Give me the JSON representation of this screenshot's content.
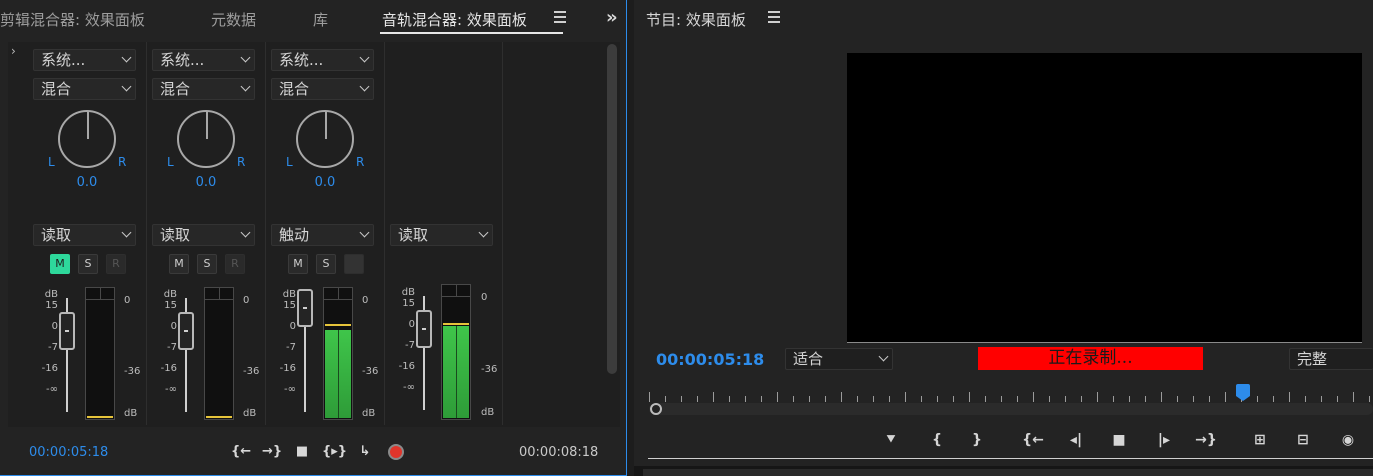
{
  "left_panel": {
    "tabs": [
      "剪辑混合器: 效果面板",
      "元数据",
      "库",
      "音轨混合器: 效果面板"
    ],
    "active_tab": "音轨混合器: 效果面板",
    "overflow_glyph": "»",
    "expander_glyph": "›",
    "tracks": [
      {
        "output": "系统...",
        "mode": "混合",
        "pan_left": "L",
        "pan_right": "R",
        "pan_value": "0.0",
        "automation": "读取",
        "mute": "M",
        "solo": "S",
        "record": "R",
        "mute_on": true,
        "meter_level": 0.0
      },
      {
        "output": "系统...",
        "mode": "混合",
        "pan_left": "L",
        "pan_right": "R",
        "pan_value": "0.0",
        "automation": "读取",
        "mute": "M",
        "solo": "S",
        "record": "R",
        "mute_on": false,
        "meter_level": 0.0
      },
      {
        "output": "系统...",
        "mode": "混合",
        "pan_left": "L",
        "pan_right": "R",
        "pan_value": "0.0",
        "automation": "触动",
        "mute": "M",
        "solo": "S",
        "record": "",
        "mute_on": false,
        "meter_level": 0.8
      },
      {
        "automation": "读取",
        "meter_level": 0.8
      }
    ],
    "db_scale_left": [
      "dB",
      "15",
      "0",
      "-7",
      "-16",
      "-∞"
    ],
    "db_scale_right": [
      "0",
      "-36",
      "dB"
    ],
    "current_time": "00:00:05:18",
    "duration": "00:00:08:18",
    "transport_icons": [
      "go-to-in-icon",
      "go-to-out-icon",
      "stop-icon",
      "loop-in-out-icon",
      "loop-icon",
      "record-icon"
    ]
  },
  "right_panel": {
    "title": "节目: 效果面板",
    "timecode": "00:00:05:18",
    "zoom": "适合",
    "recording_text": "正在录制...",
    "quality": "完整",
    "playhead_fraction": 0.82,
    "transport_icons": [
      "add-marker-icon",
      "mark-in-icon",
      "mark-out-icon",
      "go-to-in-icon",
      "step-back-icon",
      "stop-icon",
      "step-forward-icon",
      "go-to-out-icon",
      "lift-icon",
      "extract-icon",
      "export-frame-icon"
    ]
  },
  "colors": {
    "accent": "#2d8ceb",
    "mute_on": "#2ed89b",
    "record_badge": "#ff0000",
    "meter_green": "#3fc54a",
    "peak": "#e6c43a"
  }
}
